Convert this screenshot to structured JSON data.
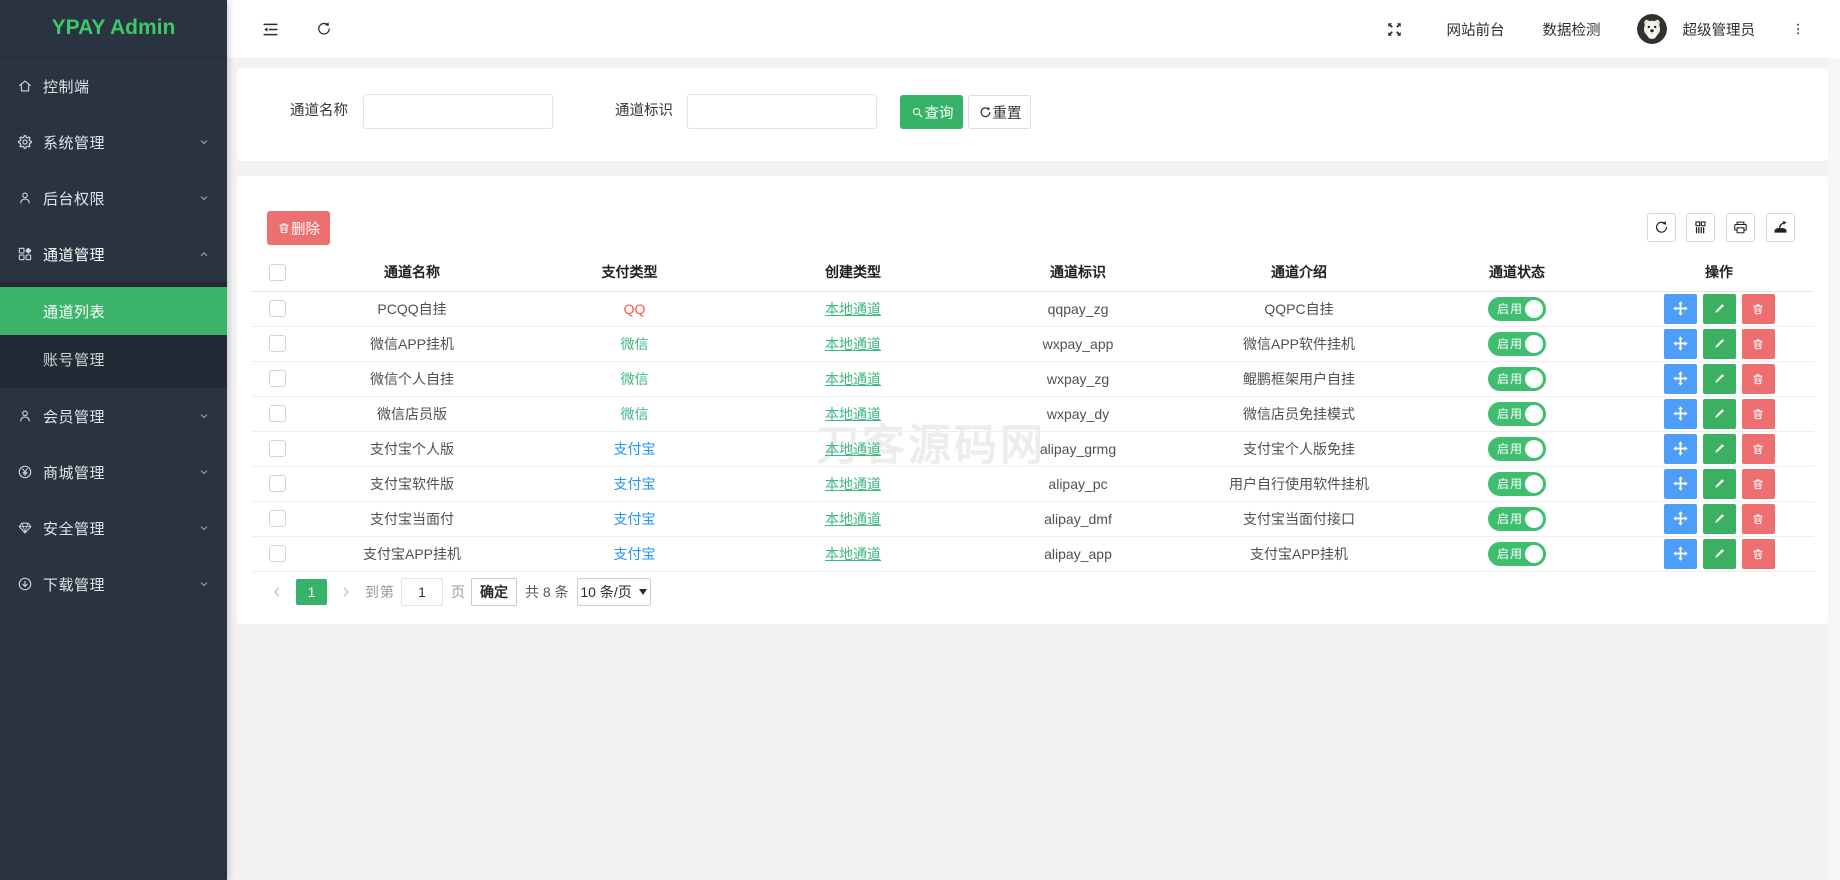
{
  "app": {
    "logo_text": "YPAY Admin"
  },
  "colors": {
    "sidebar_bg": "#2a3440",
    "submenu_bg": "#222b35",
    "accent_green": "#3cb46a",
    "logo_green": "#3dc868",
    "link_green": "#3cb881",
    "qq_red": "#ff5340",
    "alipay_blue": "#2196f3",
    "danger_red": "#ee6f6f",
    "op_blue": "#4d9ef8",
    "op_green": "#3bb060"
  },
  "sidebar": {
    "items": [
      {
        "label": "控制端",
        "icon": "home-icon",
        "expandable": false
      },
      {
        "label": "系统管理",
        "icon": "gear-icon",
        "expandable": true
      },
      {
        "label": "后台权限",
        "icon": "user-icon",
        "expandable": true
      },
      {
        "label": "通道管理",
        "icon": "components-icon",
        "expandable": true,
        "expanded": true
      },
      {
        "label": "会员管理",
        "icon": "member-icon",
        "expandable": true
      },
      {
        "label": "商城管理",
        "icon": "yen-circle-icon",
        "expandable": true
      },
      {
        "label": "安全管理",
        "icon": "gem-icon",
        "expandable": true
      },
      {
        "label": "下载管理",
        "icon": "download-circle-icon",
        "expandable": true
      }
    ],
    "submenu": [
      {
        "label": "通道列表",
        "active": true
      },
      {
        "label": "账号管理",
        "active": false
      }
    ]
  },
  "topbar": {
    "site_front": "网站前台",
    "data_check": "数据检测",
    "username": "超级管理员"
  },
  "search": {
    "name_label": "通道名称",
    "ident_label": "通道标识",
    "name_value": "",
    "ident_value": "",
    "query_label": "查询",
    "reset_label": "重置"
  },
  "toolbar": {
    "delete_label": "删除"
  },
  "table": {
    "headers": [
      "通道名称",
      "支付类型",
      "创建类型",
      "通道标识",
      "通道介绍",
      "通道状态",
      "操作"
    ],
    "status_on_label": "启用",
    "rows": [
      {
        "name": "PCQQ自挂",
        "pay_type": "QQ",
        "pay_color": "#ff5340",
        "create_type": "本地通道",
        "ident": "qqpay_zg",
        "intro": "QQPC自挂",
        "status": "启用"
      },
      {
        "name": "微信APP挂机",
        "pay_type": "微信",
        "pay_color": "#3cb881",
        "create_type": "本地通道",
        "ident": "wxpay_app",
        "intro": "微信APP软件挂机",
        "status": "启用"
      },
      {
        "name": "微信个人自挂",
        "pay_type": "微信",
        "pay_color": "#3cb881",
        "create_type": "本地通道",
        "ident": "wxpay_zg",
        "intro": "鲲鹏框架用户自挂",
        "status": "启用"
      },
      {
        "name": "微信店员版",
        "pay_type": "微信",
        "pay_color": "#3cb881",
        "create_type": "本地通道",
        "ident": "wxpay_dy",
        "intro": "微信店员免挂模式",
        "status": "启用"
      },
      {
        "name": "支付宝个人版",
        "pay_type": "支付宝",
        "pay_color": "#2196f3",
        "create_type": "本地通道",
        "ident": "alipay_grmg",
        "intro": "支付宝个人版免挂",
        "status": "启用"
      },
      {
        "name": "支付宝软件版",
        "pay_type": "支付宝",
        "pay_color": "#2196f3",
        "create_type": "本地通道",
        "ident": "alipay_pc",
        "intro": "用户自行使用软件挂机",
        "status": "启用"
      },
      {
        "name": "支付宝当面付",
        "pay_type": "支付宝",
        "pay_color": "#2196f3",
        "create_type": "本地通道",
        "ident": "alipay_dmf",
        "intro": "支付宝当面付接口",
        "status": "启用"
      },
      {
        "name": "支付宝APP挂机",
        "pay_type": "支付宝",
        "pay_color": "#2196f3",
        "create_type": "本地通道",
        "ident": "alipay_app",
        "intro": "支付宝APP挂机",
        "status": "启用"
      }
    ]
  },
  "pagination": {
    "current_page": "1",
    "goto_prefix": "到第",
    "goto_value": "1",
    "goto_suffix": "页",
    "confirm_label": "确定",
    "total_text": "共 8 条",
    "page_size": "10 条/页"
  },
  "watermark": "刀客源码网"
}
